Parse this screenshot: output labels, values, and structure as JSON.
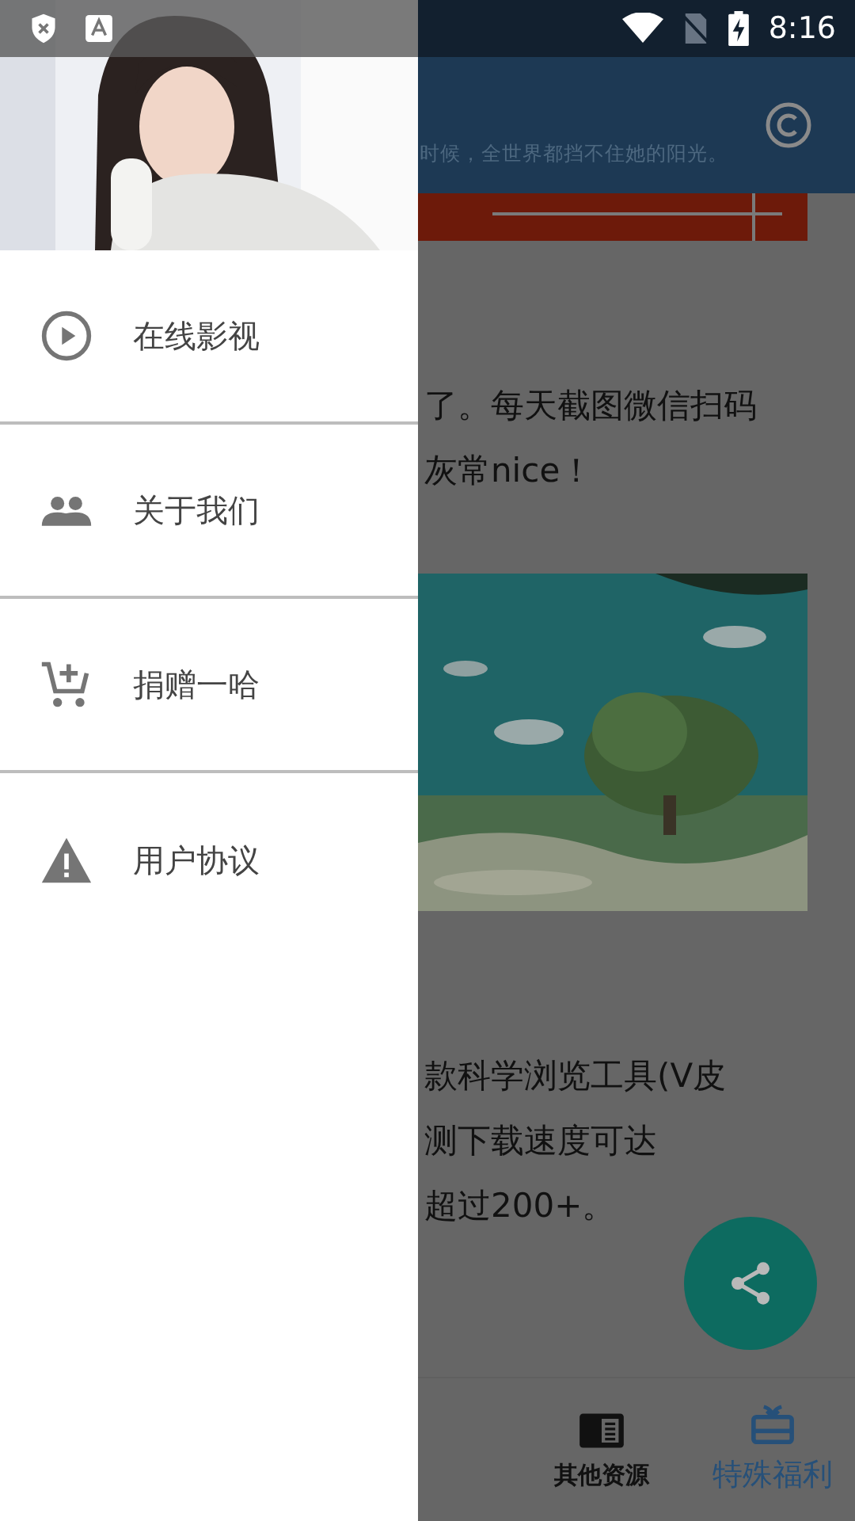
{
  "status_bar": {
    "time": "8:16"
  },
  "app_bar": {
    "subtitle": "时候，全世界都挡不住她的阳光。"
  },
  "article": {
    "paragraph_1": [
      "了。每天截图微信扫码",
      "灰常nice！"
    ],
    "paragraph_2": [
      "款科学浏览工具(V皮",
      "测下载速度可达",
      "超过200+。"
    ]
  },
  "drawer": {
    "items": [
      {
        "label": "在线影视"
      },
      {
        "label": "关于我们"
      },
      {
        "label": "捐赠一哈"
      },
      {
        "label": "用户协议"
      }
    ]
  },
  "bottom_nav": {
    "tabs": [
      {
        "label": "其他资源",
        "selected": false
      },
      {
        "label": "特殊福利",
        "selected": true
      }
    ]
  }
}
